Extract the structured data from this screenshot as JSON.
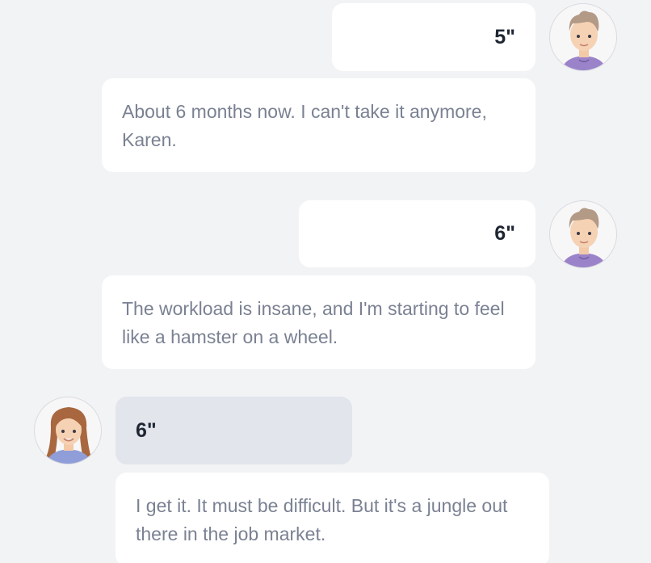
{
  "conversation": {
    "messages": [
      {
        "speaker": "male",
        "duration": "5\"",
        "text": "About 6 months now. I can't take it anymore, Karen."
      },
      {
        "speaker": "male",
        "duration": "6\"",
        "text": "The workload is insane, and I'm starting to feel like a hamster on a wheel."
      },
      {
        "speaker": "female",
        "duration": "6\"",
        "text": "I get it. It must be difficult. But it's a jungle out there in the job market."
      }
    ]
  },
  "icons": {
    "male_avatar": "male-avatar-icon",
    "female_avatar": "female-avatar-icon"
  },
  "colors": {
    "background": "#f2f3f5",
    "bubble_white": "#ffffff",
    "bubble_gray": "#e2e5ec",
    "message_text": "#7a8192",
    "duration_text": "#1f2633",
    "male_shirt": "#9a83c9",
    "female_shirt": "#8f9ed8"
  }
}
